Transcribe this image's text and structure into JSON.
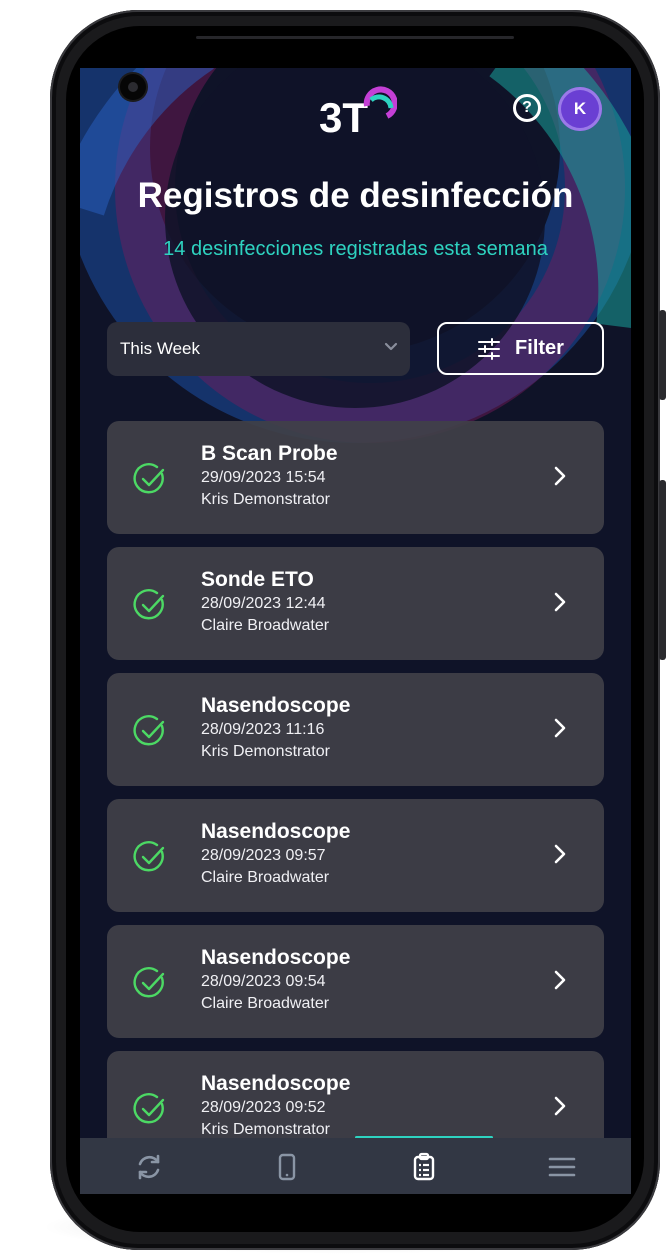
{
  "header": {
    "logo_text": "3T",
    "help_symbol": "?",
    "avatar_initial": "K"
  },
  "page": {
    "title": "Registros de desinfección",
    "subtitle": "14 desinfecciones registradas esta semana"
  },
  "controls": {
    "range_value": "This Week",
    "filter_label": "Filter"
  },
  "records": [
    {
      "device": "B Scan Probe",
      "time": "29/09/2023 15:54",
      "user": "Kris Demonstrator",
      "status": "passed"
    },
    {
      "device": "Sonde ETO",
      "time": "28/09/2023 12:44",
      "user": "Claire Broadwater",
      "status": "passed"
    },
    {
      "device": "Nasendoscope",
      "time": "28/09/2023 11:16",
      "user": "Kris Demonstrator",
      "status": "passed"
    },
    {
      "device": "Nasendoscope",
      "time": "28/09/2023 09:57",
      "user": "Claire Broadwater",
      "status": "passed"
    },
    {
      "device": "Nasendoscope",
      "time": "28/09/2023 09:54",
      "user": "Claire Broadwater",
      "status": "passed"
    },
    {
      "device": "Nasendoscope",
      "time": "28/09/2023 09:52",
      "user": "Kris Demonstrator",
      "status": "passed"
    }
  ],
  "tabs": [
    {
      "label": "Ciclo",
      "icon": "refresh-icon",
      "active": false
    },
    {
      "label": "Dispositivo",
      "icon": "phone-icon",
      "active": false
    },
    {
      "label": "Registro",
      "icon": "clipboard-icon",
      "active": true
    },
    {
      "label": "Más",
      "icon": "menu-icon",
      "active": false
    }
  ],
  "colors": {
    "background": "#0f1328",
    "card": "#404048",
    "accent": "#2ed3c0",
    "success": "#4cd964",
    "avatar": "#6a3fd3",
    "tabbar": "#323744"
  }
}
